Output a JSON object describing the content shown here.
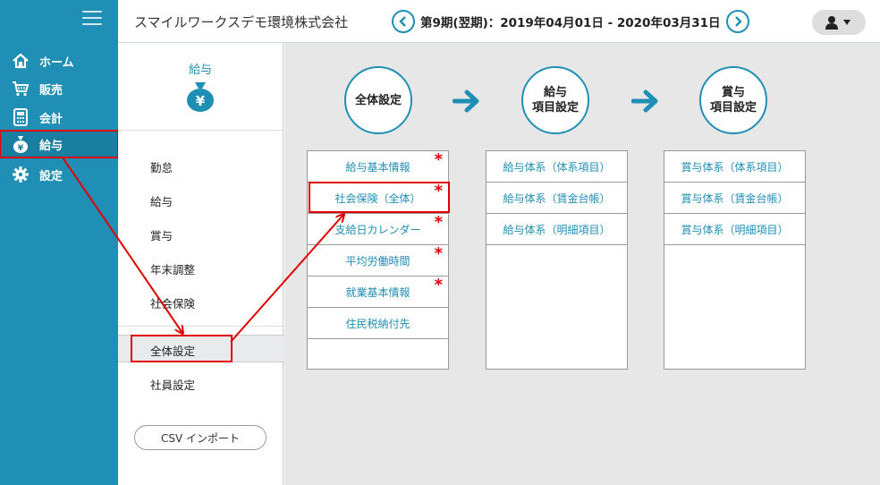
{
  "sidebar": {
    "items": [
      {
        "label": "ホーム",
        "icon": "home-icon"
      },
      {
        "label": "販売",
        "icon": "cart-icon"
      },
      {
        "label": "会計",
        "icon": "calculator-icon"
      },
      {
        "label": "給与",
        "icon": "money-bag-icon"
      },
      {
        "label": "設定",
        "icon": "gear-icon"
      }
    ]
  },
  "header": {
    "company": "スマイルワークスデモ環境株式会社",
    "period": "第9期(翌期)：2019年04月01日 - 2020年03月31日"
  },
  "subnav": {
    "title": "給与",
    "items": [
      "勤怠",
      "給与",
      "賞与",
      "年末調整",
      "社会保険",
      "全体設定",
      "社員設定"
    ],
    "csv_button": "CSV インポート"
  },
  "steps": [
    {
      "line1": "全体設定",
      "line2": ""
    },
    {
      "line1": "給与",
      "line2": "項目設定"
    },
    {
      "line1": "賞与",
      "line2": "項目設定"
    }
  ],
  "columns": [
    {
      "items": [
        "給与基本情報",
        "社会保険（全体）",
        "支給日カレンダー",
        "平均労働時間",
        "就業基本情報",
        "住民税納付先"
      ],
      "required": [
        true,
        true,
        true,
        true,
        true,
        false
      ]
    },
    {
      "items": [
        "給与体系（体系項目）",
        "給与体系（賃金台帳）",
        "給与体系（明細項目）"
      ]
    },
    {
      "items": [
        "賞与体系（体系項目）",
        "賞与体系（賃金台帳）",
        "賞与体系（明細項目）"
      ]
    }
  ],
  "required_mark": "*",
  "colors": {
    "accent": "#1f8fb5",
    "highlight": "#e00000"
  }
}
